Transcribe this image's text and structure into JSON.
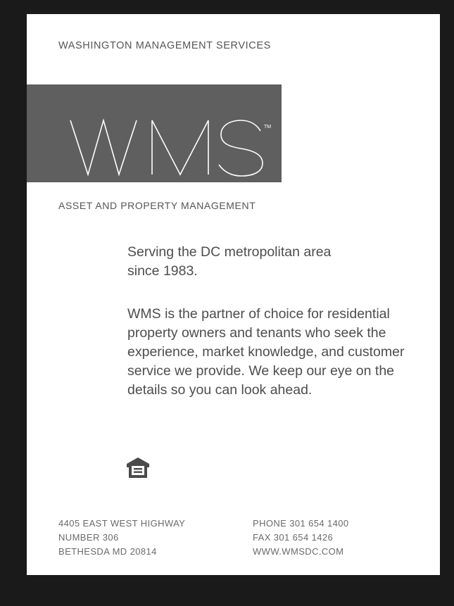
{
  "header": {
    "company_name": "WASHINGTON MANAGEMENT SERVICES"
  },
  "logo": {
    "text": "WMS",
    "trademark": "TM"
  },
  "tagline": "ASSET AND PROPERTY MANAGEMENT",
  "body": {
    "paragraph_1": "Serving the DC metropolitan area since 1983.",
    "paragraph_2": "WMS is the partner of choice for residential property owners and tenants who seek the experience, market knowledge, and customer service we provide. We keep our eye on the details so you can look ahead."
  },
  "icons": {
    "equal_housing": "equal-housing-opportunity-icon"
  },
  "footer": {
    "address_line_1": "4405 EAST WEST HIGHWAY",
    "address_line_2": "NUMBER 306",
    "address_line_3": "BETHESDA MD 20814",
    "phone": "PHONE 301 654 1400",
    "fax": "FAX 301 654 1426",
    "website": "WWW.WMSDC.COM"
  },
  "colors": {
    "background": "#1a1a1a",
    "page": "#ffffff",
    "logo_band": "#5f5f5f",
    "text": "#4d4d4d"
  }
}
